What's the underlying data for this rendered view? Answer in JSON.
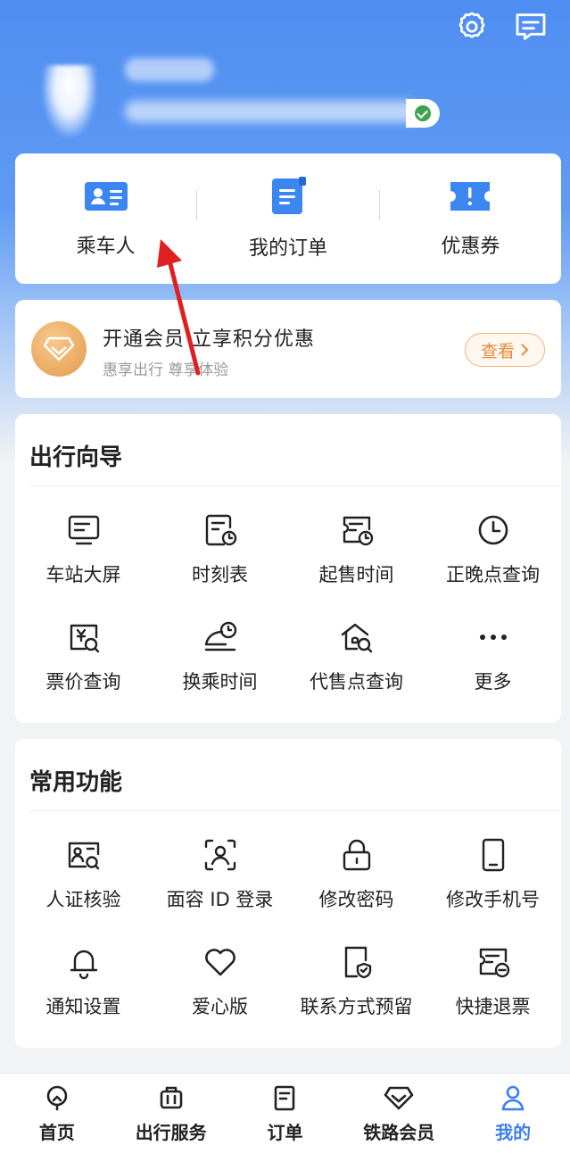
{
  "quick_links": [
    {
      "label": "乘车人",
      "icon": "id-card-icon"
    },
    {
      "label": "我的订单",
      "icon": "order-document-icon"
    },
    {
      "label": "优惠券",
      "icon": "coupon-ticket-icon"
    }
  ],
  "membership": {
    "title": "开通会员  立享积分优惠",
    "subtitle": "惠享出行 尊享体验",
    "button_label": "查看"
  },
  "travel_guide": {
    "title": "出行向导",
    "items": [
      {
        "label": "车站大屏",
        "icon": "station-screen-icon"
      },
      {
        "label": "时刻表",
        "icon": "timetable-icon"
      },
      {
        "label": "起售时间",
        "icon": "sale-time-icon"
      },
      {
        "label": "正晚点查询",
        "icon": "clock-icon"
      },
      {
        "label": "票价查询",
        "icon": "fare-search-icon"
      },
      {
        "label": "换乘时间",
        "icon": "transfer-time-icon"
      },
      {
        "label": "代售点查询",
        "icon": "agency-search-icon"
      },
      {
        "label": "更多",
        "icon": "more-dots-icon"
      }
    ]
  },
  "common_functions": {
    "title": "常用功能",
    "items": [
      {
        "label": "人证核验",
        "icon": "id-verify-icon"
      },
      {
        "label": "面容 ID 登录",
        "icon": "face-id-icon"
      },
      {
        "label": "修改密码",
        "icon": "lock-icon"
      },
      {
        "label": "修改手机号",
        "icon": "phone-icon"
      },
      {
        "label": "通知设置",
        "icon": "bell-icon"
      },
      {
        "label": "爱心版",
        "icon": "heart-icon"
      },
      {
        "label": "联系方式预留",
        "icon": "contact-shield-icon"
      },
      {
        "label": "快捷退票",
        "icon": "quick-refund-icon"
      }
    ]
  },
  "bottom_nav": [
    {
      "label": "首页",
      "icon": "home-train-icon"
    },
    {
      "label": "出行服务",
      "icon": "luggage-icon"
    },
    {
      "label": "订单",
      "icon": "order-list-icon"
    },
    {
      "label": "铁路会员",
      "icon": "diamond-icon"
    },
    {
      "label": "我的",
      "icon": "user-icon",
      "active": true
    }
  ],
  "colors": {
    "primary": "#3b7ff0",
    "accent_orange": "#e38a3c"
  }
}
